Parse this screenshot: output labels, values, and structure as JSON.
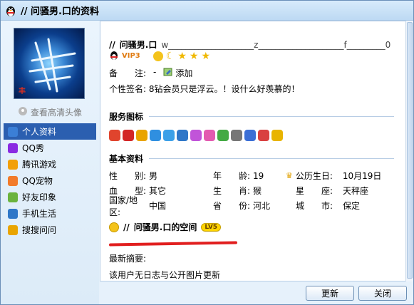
{
  "window": {
    "title": "// 问骚男.口的资料"
  },
  "sidebar": {
    "hd_link": "查看高清头像",
    "items": [
      {
        "label": "个人资料",
        "icon": "profile-icon",
        "color": "#3b7fd6",
        "active": true
      },
      {
        "label": "QQ秀",
        "icon": "qq-show-icon",
        "color": "#8a2be2",
        "active": false
      },
      {
        "label": "腾讯游戏",
        "icon": "game-icon",
        "color": "#f2a007",
        "active": false
      },
      {
        "label": "QQ宠物",
        "icon": "pet-icon",
        "color": "#f27b2a",
        "active": false
      },
      {
        "label": "好友印象",
        "icon": "impression-icon",
        "color": "#6bb33e",
        "active": false
      },
      {
        "label": "手机生活",
        "icon": "mobile-icon",
        "color": "#2f77c8",
        "active": false
      },
      {
        "label": "搜搜问问",
        "icon": "soso-icon",
        "color": "#e9a400",
        "active": false
      }
    ]
  },
  "profile": {
    "name_prefix": "//",
    "name": "问骚男.口",
    "name_trailing": "w____________________z____________________f_________0",
    "vip": "VIP3",
    "remark_label": "备　　注:",
    "remark_value": "-",
    "add_label": "添加",
    "signature": "个性签名: 8钻会员只是浮云。！设什么好羡慕的！"
  },
  "sections": {
    "service": "服务图标",
    "basic": "基本资料"
  },
  "service_icon_colors": [
    "#e0442d",
    "#d32626",
    "#e9a400",
    "#2f8fe0",
    "#3ca0e8",
    "#2f77c8",
    "#c154d9",
    "#e35bb0",
    "#44aa44",
    "#777777",
    "#3b6fd6",
    "#d94040",
    "#e8b400"
  ],
  "basic_info": [
    {
      "l1": "性　　别:",
      "v1": "男",
      "l2": "年　　龄:",
      "v2": "19",
      "l3": "公历生日:",
      "v3": "10月19日"
    },
    {
      "l1": "血　　型:",
      "v1": "其它",
      "l2": "生　　肖:",
      "v2": "猴",
      "l3": "星　　座:",
      "v3": "天秤座"
    },
    {
      "l1": "国家/地区:",
      "v1": "中国",
      "l2": "省　　份:",
      "v2": "河北",
      "l3": "城　　市:",
      "v3": "保定"
    }
  ],
  "space": {
    "prefix": "//",
    "title": "问骚男.口的空间",
    "level": "LV5",
    "latest_label": "最新摘要:",
    "latest_text": "该用户无日志与公开图片更新"
  },
  "buttons": {
    "update": "更新",
    "close": "关闭"
  }
}
